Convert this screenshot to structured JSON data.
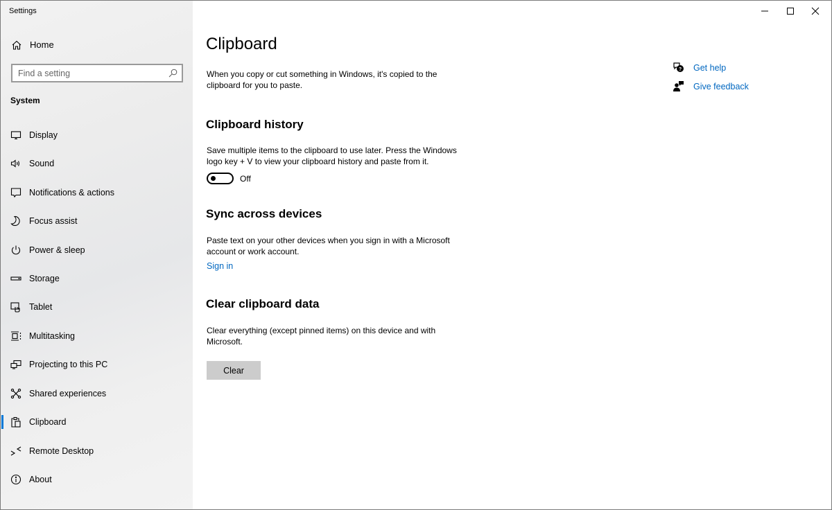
{
  "window": {
    "title": "Settings",
    "controls": {
      "minimize": "minimize-icon",
      "maximize": "maximize-icon",
      "close": "close-icon"
    }
  },
  "sidebar": {
    "home": {
      "label": "Home",
      "icon": "home-icon"
    },
    "search": {
      "placeholder": "Find a setting",
      "value": "",
      "icon": "search-icon"
    },
    "section": "System",
    "items": [
      {
        "label": "Display",
        "icon": "display-icon",
        "active": false
      },
      {
        "label": "Sound",
        "icon": "speaker-icon",
        "active": false
      },
      {
        "label": "Notifications & actions",
        "icon": "notification-icon",
        "active": false
      },
      {
        "label": "Focus assist",
        "icon": "moon-icon",
        "active": false
      },
      {
        "label": "Power & sleep",
        "icon": "power-icon",
        "active": false
      },
      {
        "label": "Storage",
        "icon": "storage-icon",
        "active": false
      },
      {
        "label": "Tablet",
        "icon": "tablet-icon",
        "active": false
      },
      {
        "label": "Multitasking",
        "icon": "multitasking-icon",
        "active": false
      },
      {
        "label": "Projecting to this PC",
        "icon": "projecting-icon",
        "active": false
      },
      {
        "label": "Shared experiences",
        "icon": "shared-experiences-icon",
        "active": false
      },
      {
        "label": "Clipboard",
        "icon": "clipboard-icon",
        "active": true
      },
      {
        "label": "Remote Desktop",
        "icon": "remote-desktop-icon",
        "active": false
      },
      {
        "label": "About",
        "icon": "info-icon",
        "active": false
      }
    ]
  },
  "main": {
    "title": "Clipboard",
    "intro": "When you copy or cut something in Windows, it's copied to the clipboard for you to paste.",
    "history": {
      "heading": "Clipboard history",
      "description": "Save multiple items to the clipboard to use later. Press the Windows logo key + V to view your clipboard history and paste from it.",
      "toggle_state": "Off",
      "toggle_on": false
    },
    "sync": {
      "heading": "Sync across devices",
      "description": "Paste text on your other devices when you sign in with a Microsoft account or work account.",
      "link": "Sign in"
    },
    "clear": {
      "heading": "Clear clipboard data",
      "description": "Clear everything (except pinned items) on this device and with Microsoft.",
      "button": "Clear"
    },
    "help": {
      "get_help": "Get help",
      "give_feedback": "Give feedback"
    }
  },
  "colors": {
    "accent": "#0078d7",
    "link": "#0067c0",
    "button_bg": "#cccccc"
  }
}
